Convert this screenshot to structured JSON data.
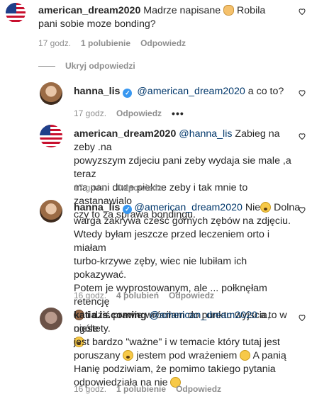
{
  "comments": [
    {
      "username": "american_dream2020",
      "text_a": "Madrze napisane",
      "text_b": "Robila pani sobie moze bonding?",
      "time": "17 godz.",
      "likes": "1 polubienie",
      "reply": "Odpowiedz"
    }
  ],
  "hide_replies": "Ukryj odpowiedzi",
  "replies": [
    {
      "username": "hanna_lis",
      "mention": "@american_dream2020",
      "text": "a co to?",
      "time": "17 godz.",
      "reply": "Odpowiedz",
      "more": "•••"
    },
    {
      "username": "american_dream2020",
      "mention": "@hanna_lis",
      "line1_rest": "Zabieg na zeby .na",
      "line2": "powyzszym zdjeciu pani zeby wydaja sie male ,a teraz",
      "line3": "ma pani duze piekne zeby i tak mnie to zastanawialo",
      "line4": "czy to za sprawa bondingu.",
      "time": "17 godz.",
      "reply": "Odpowiedz"
    },
    {
      "username": "hanna_lis",
      "mention": "@american_dream2020",
      "line1_rest_a": "Nie",
      "line1_rest_b": "Dolna",
      "line2": "warga zakrywa cześć górnych zębów na zdjęciu.",
      "line3": "Wtedy byłam jeszcze przed leczeniem orto i miałam",
      "line4": "turbo-krzywe zęby, wiec nie lubiłam ich pokazywać.",
      "line5": "Potem je wyprostowanym, ale ... połknęłam retencję",
      "line6": "i dziś prawie wróciłam do punktu wyjscia, niestety.",
      "time": "16 godz.",
      "likes": "4 polubień",
      "reply": "Odpowiedz"
    },
    {
      "username": "katia.is.coming",
      "mention": "@american_dream2020",
      "line1_rest": "a to w ogóle",
      "line2": "jest bardzo \"ważne\" i w temacie który tutaj jest",
      "line3_a": "poruszany",
      "line3_b": "jestem pod wrażeniem",
      "line3_c": "A panią",
      "line4": "Hanię podziwiam, że pomimo takiego pytania",
      "line5": "odpowiedziała na nie",
      "time": "16 godz.",
      "likes": "1 polubienie",
      "reply": "Odpowiedz"
    }
  ],
  "colors": {
    "mention": "#00376b",
    "meta": "#8e8e8e",
    "verified": "#3897f0"
  }
}
